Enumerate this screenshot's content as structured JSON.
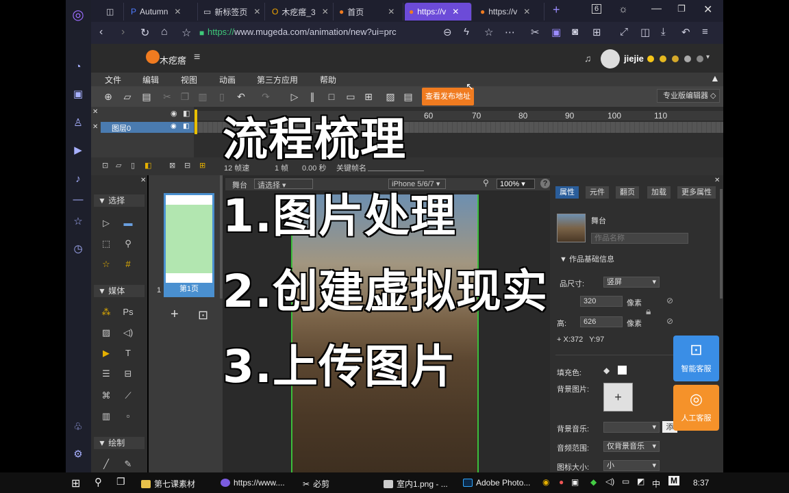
{
  "browser": {
    "tabs": [
      {
        "label": "Autumn"
      },
      {
        "label": "新标签页"
      },
      {
        "label": "木疙瘩_3"
      },
      {
        "label": "首页"
      },
      {
        "label": "https://v"
      },
      {
        "label": "https://v"
      }
    ],
    "tab_count": "6",
    "url_prefix": "https://",
    "url_rest": "www.mugeda.com/animation/new?ui=prc"
  },
  "app": {
    "logo_text": "木疙瘩",
    "user_name": "jiejie"
  },
  "menu": [
    "文件",
    "编辑",
    "视图",
    "动画",
    "第三方应用",
    "帮助"
  ],
  "toolbar": {
    "publish_button": "查看发布地址",
    "editor_mode": "专业版编辑器"
  },
  "timeline": {
    "layer_name": "图层0",
    "ruler": [
      "60",
      "70",
      "80",
      "90",
      "100",
      "110"
    ],
    "fps": "12 帧速",
    "frame": "1 帧",
    "time": "0.00 秒",
    "keyframe_label": "关键帧名"
  },
  "left_panel": {
    "select_label": "选择",
    "media_label": "媒体",
    "draw_label": "绘制"
  },
  "page_panel": {
    "page_number": "1",
    "page_label": "第1页"
  },
  "stage_bar": {
    "stage_label": "舞台",
    "select_placeholder": "请选择",
    "device": "iPhone 5/6/7",
    "zoom": "100%"
  },
  "right_panel": {
    "tabs": [
      "属性",
      "元件",
      "翻页",
      "加载",
      "更多属性"
    ],
    "stage_label": "舞台",
    "work_name_placeholder": "作品名称",
    "basic_info": "作品基础信息",
    "size_label": "品尺寸:",
    "size_value": "竖屏",
    "width_value": "320",
    "unit_px": "像素",
    "height_label": "高:",
    "height_value": "626",
    "coords": "X:372   Y:97",
    "fill_label": "填充色:",
    "bg_image_label": "背景图片:",
    "bg_music_label": "背景音乐:",
    "add_label": "添",
    "music_scope_label": "音频范围:",
    "music_scope_value": "仅背景音乐",
    "icon_size_label": "图标大小:",
    "icon_size_value": "小"
  },
  "service": {
    "ai": "智能客服",
    "human": "人工客服"
  },
  "overlay": {
    "title": "流程梳理",
    "line1": "1.图片处理",
    "line2": "2.创建虚拟现实",
    "line3": "3.上传图片"
  },
  "taskbar": {
    "items": [
      "第七课素材",
      "https://www....",
      "必剪",
      "室内1.png - ...",
      "Adobe Photo..."
    ],
    "ime": "中",
    "time": "8:37"
  }
}
